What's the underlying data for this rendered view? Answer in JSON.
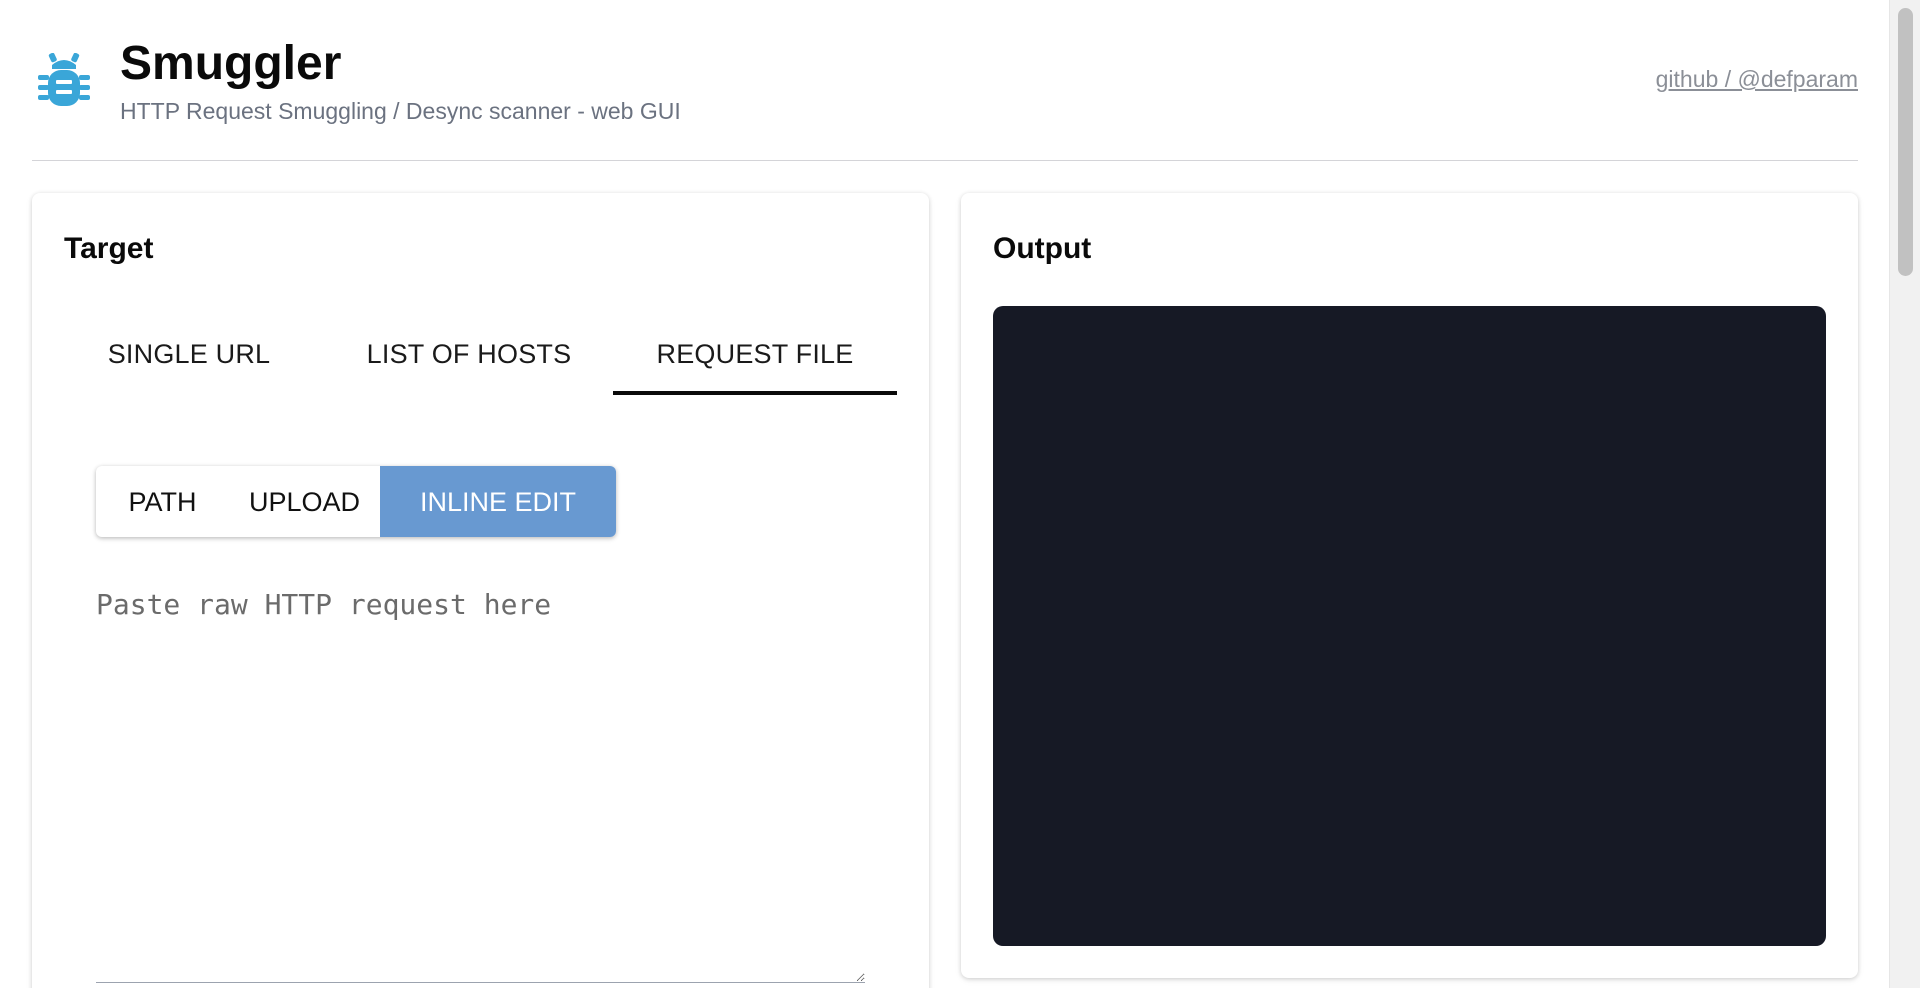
{
  "header": {
    "title": "Smuggler",
    "subtitle": "HTTP Request Smuggling / Desync scanner - web GUI",
    "github_link": "github / @defparam",
    "logo_icon": "bug-icon",
    "logo_color": "#3aa6d8"
  },
  "target": {
    "title": "Target",
    "tabs": [
      {
        "label": "SINGLE URL",
        "active": false
      },
      {
        "label": "LIST OF HOSTS",
        "active": false
      },
      {
        "label": "REQUEST FILE",
        "active": true
      }
    ],
    "mode": {
      "options": [
        {
          "label": "PATH",
          "active": false
        },
        {
          "label": "UPLOAD",
          "active": false
        },
        {
          "label": "INLINE EDIT",
          "active": true
        }
      ],
      "active_color": "#6899d1"
    },
    "raw_request": {
      "value": "",
      "placeholder": "Paste raw HTTP request here"
    }
  },
  "output": {
    "title": "Output",
    "console_text": "",
    "console_bg": "#161925"
  }
}
